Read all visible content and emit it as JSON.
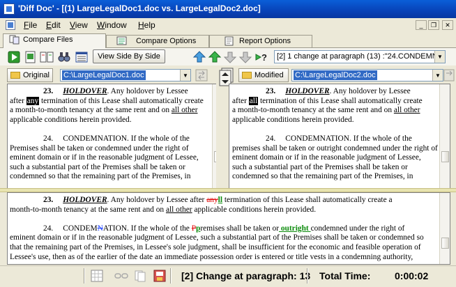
{
  "window": {
    "title": "'Diff Doc' - [(1) LargeLegalDoc1.doc vs. LargeLegalDoc2.doc]"
  },
  "menu": [
    "File",
    "Edit",
    "View",
    "Window",
    "Help"
  ],
  "mdi_controls": [
    "_",
    "❐",
    "✕"
  ],
  "tabs": [
    "Compare Files",
    "Compare Options",
    "Report Options"
  ],
  "toolbar": {
    "view_button": "View Side By Side",
    "change_select": "[2] 1 change at paragraph (13) :\"24.CONDEMN"
  },
  "files": {
    "original_label": "Original",
    "original_path": "C:\\LargeLegalDoc1.doc",
    "modified_label": "Modified",
    "modified_path": "C:\\LargeLegalDoc2.doc"
  },
  "left_pane": {
    "num23": "23.",
    "holdover": "HOLDOVER",
    "l1": ".  Any holdover by Lessee",
    "l2a": "after ",
    "l2b": "any",
    "l2c": " termination of this Lease shall automatically create",
    "l3a": "a month-to-month tenancy at the same rent and on ",
    "l3b": "all other",
    "l4": "applicable conditions herein provided.",
    "num24": "24.",
    "condemnation": "CONDEMNATION.  If the whole of the",
    "l6": "Premises shall be taken or condemned under the right of",
    "l7": "eminent domain or if in the reasonable judgment of Lessee,",
    "l8": "such a substantial part of the Premises shall be taken or",
    "l9": "condemned so that the remaining part of the Premises, in"
  },
  "right_pane": {
    "num23": "23.",
    "holdover": "HOLDOVER",
    "l1": ".  Any holdover by Lessee",
    "l2a": "after ",
    "l2b": "all",
    "l2c": " termination of this Lease shall automatically create",
    "l3a": "a month-to-month tenancy at the same rent and on ",
    "l3b": "all other",
    "l4": "applicable conditions herein provided.",
    "num24": "24.",
    "condemnation": "CONDEMNATION.  If the whole of the",
    "l6": "premises shall be taken or outright condemned under the right of",
    "l7": "eminent domain or if in the reasonable judgment of Lessee,",
    "l8": "such a substantial part of the Premises shall be taken or",
    "l9": "condemned so that the remaining part of the Premises, in"
  },
  "bottom_pane": {
    "num23": "23.",
    "holdover": "HOLDOVER",
    "l1a": ".  Any holdover by Lessee after ",
    "l1_del": "any",
    "l1_ins": "ll",
    "l1b": " termination of this Lease shall automatically create a",
    "l2a": "month-to-month tenancy at the same rent and on ",
    "l2b": "all other",
    "l2c": " applicable conditions herein provided.",
    "num24": "24.",
    "cond_a": "CONDEM",
    "cond_mv": "N",
    "cond_b": "ATION.  If the whole of the ",
    "cond_del": "P",
    "cond_ins": "p",
    "cond_c": "remises shall be taken or",
    "cond_out": " outright ",
    "cond_d": " condemned under the right of",
    "l4": "eminent domain or if in the reasonable judgment of Lessee, such a substantial part of the Premises shall be taken or condemned so",
    "l5": "that the remaining part of the Premises, in Lessee's sole judgment, shall be insufficient for the economic and feasible operation of",
    "l6": "Lessee's use, then as of the earlier of the date an immediate possession order is entered or title vests in a condemning authority,"
  },
  "status": {
    "change": "[2] Change at paragraph:  13",
    "time_label": "Total Time:",
    "time_value": "0:00:02"
  },
  "colors": {
    "deleted": "#e00000",
    "inserted": "#0a8a0a",
    "moved": "#1a3fff",
    "highlight": "#000000",
    "selection": "#316ac5"
  }
}
